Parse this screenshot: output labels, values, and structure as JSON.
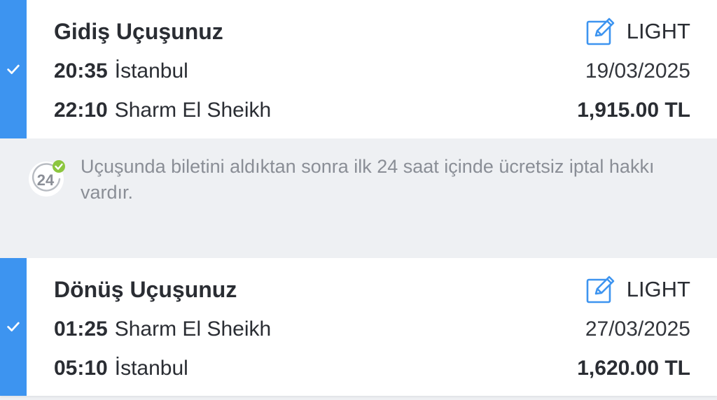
{
  "outbound": {
    "title": "Gidiş Uçuşunuz",
    "fare_class": "LIGHT",
    "departure": {
      "time": "20:35",
      "city": "İstanbul"
    },
    "arrival": {
      "time": "22:10",
      "city": "Sharm El Sheikh"
    },
    "date": "19/03/2025",
    "price": "1,915.00 TL"
  },
  "notice": {
    "badge_number": "24",
    "text": "Uçuşunda biletini aldıktan sonra ilk 24 saat içinde ücretsiz iptal hakkı vardır."
  },
  "inbound": {
    "title": "Dönüş Uçuşunuz",
    "fare_class": "LIGHT",
    "departure": {
      "time": "01:25",
      "city": "Sharm El Sheikh"
    },
    "arrival": {
      "time": "05:10",
      "city": "İstanbul"
    },
    "date": "27/03/2025",
    "price": "1,620.00 TL"
  },
  "colors": {
    "accent": "#3d94f0",
    "text": "#2a2d33",
    "muted": "#8a8e96",
    "background": "#eef0f3",
    "success": "#8cc63f"
  },
  "icons": {
    "selected": "check-icon",
    "edit": "edit-pencil-icon",
    "cancellation": "24-hour-cancellation-icon"
  }
}
